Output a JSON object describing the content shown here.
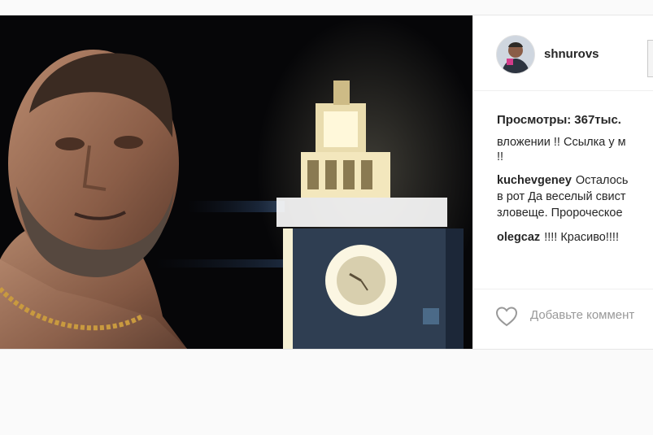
{
  "post": {
    "username": "shnurovs",
    "views_label": "Просмотры:",
    "views_count": "367тыс.",
    "comments": [
      {
        "user": "",
        "lines": [
          "вложении !! Ссылка у м",
          "!!"
        ]
      },
      {
        "user": "kuchevgeney",
        "lines": [
          "Осталось",
          "в рот Да веселый свист",
          "зловеще. Пророческое"
        ]
      },
      {
        "user": "olegcaz",
        "lines": [
          "!!!! Красиво!!!!"
        ]
      }
    ],
    "add_comment_placeholder": "Добавьте коммент"
  },
  "icons": {
    "like": "heart-icon",
    "avatar": "avatar-image"
  },
  "colors": {
    "text": "#262626",
    "muted": "#999999",
    "border": "#efefef"
  }
}
